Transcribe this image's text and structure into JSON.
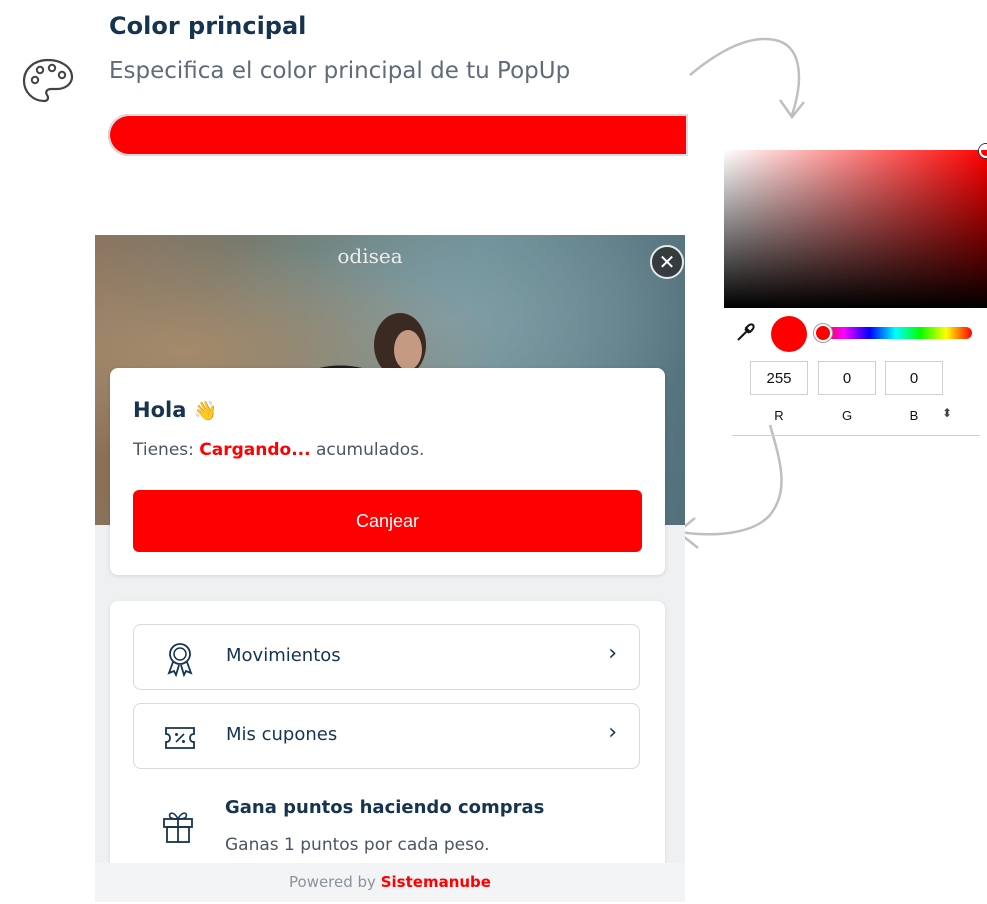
{
  "header": {
    "title": "Color principal",
    "subtitle": "Especifica el color principal de tu PopUp"
  },
  "color_input": {
    "value_color": "#fe0000"
  },
  "picker": {
    "rgb": {
      "r": "255",
      "g": "0",
      "b": "0"
    },
    "labels": {
      "r": "R",
      "g": "G",
      "b": "B"
    },
    "mode_toggle": "⬍"
  },
  "popup": {
    "brand": "odisea",
    "close_icon": "✕",
    "greeting": "Hola",
    "greeting_emoji": "👋",
    "balance_prefix": "Tienes:",
    "balance_value": "Cargando...",
    "balance_suffix": "acumulados.",
    "redeem_label": "Canjear",
    "menu": [
      {
        "label": "Movimientos",
        "icon": "award-icon"
      },
      {
        "label": "Mis cupones",
        "icon": "coupon-icon"
      }
    ],
    "earn": {
      "title": "Gana puntos haciendo compras",
      "description": "Ganas 1 puntos por cada peso."
    },
    "footer": {
      "prefix": "Powered by",
      "brand": "Sistemanube"
    }
  },
  "colors": {
    "accent": "#fe0000",
    "navy": "#16344f"
  }
}
